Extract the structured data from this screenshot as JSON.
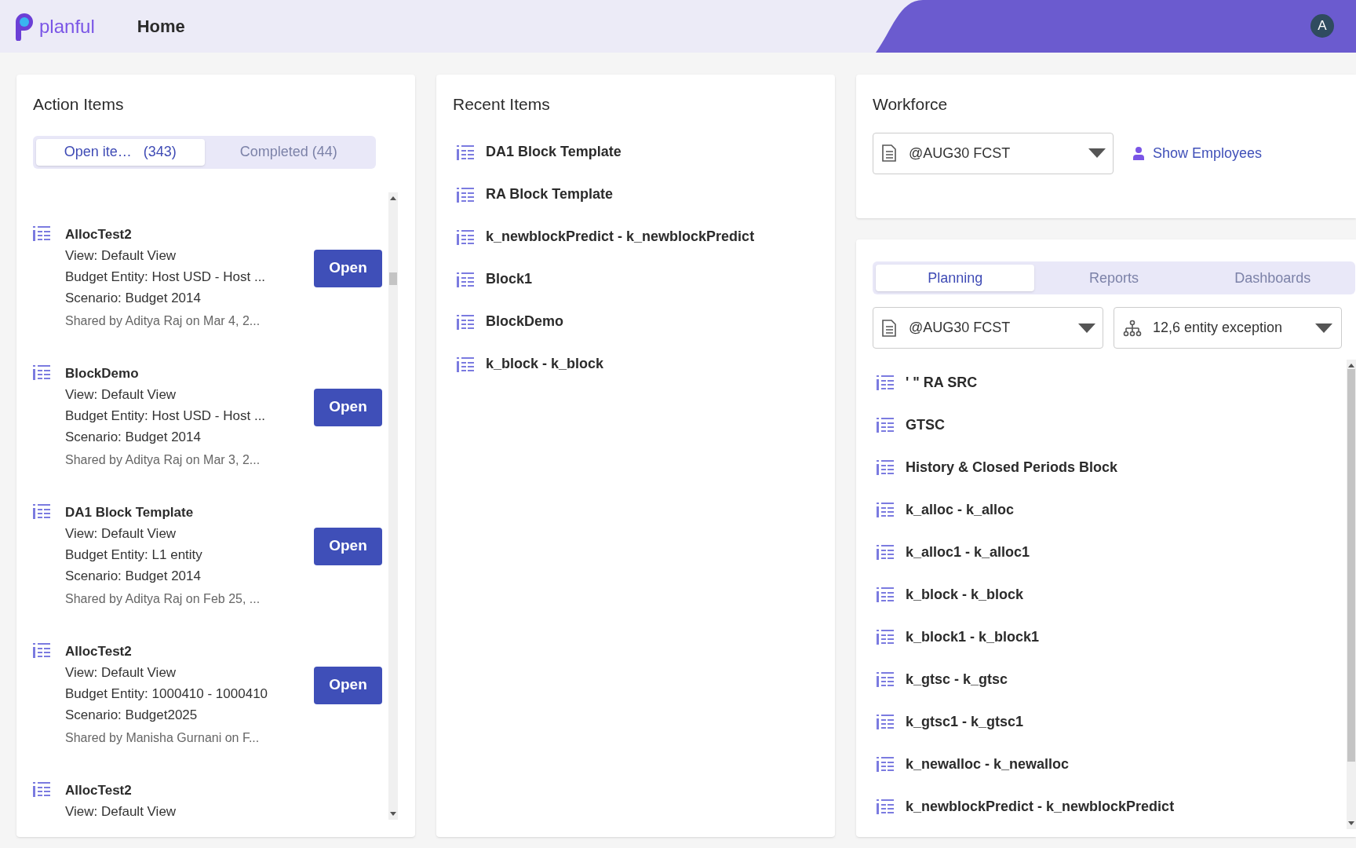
{
  "header": {
    "brand": "planful",
    "title": "Home",
    "avatar": "A"
  },
  "action_items": {
    "title": "Action Items",
    "tabs": [
      {
        "label": "Open ite…   (343)",
        "selected": true
      },
      {
        "label": "Completed (44)",
        "selected": false
      }
    ],
    "items": [
      {
        "name": "AllocTest2",
        "lines": [
          "View: Default View",
          "Budget Entity: Host USD - Host ...",
          "Scenario: Budget 2014"
        ],
        "shared": "Shared by Aditya Raj on Mar 4, 2...",
        "button": "Open"
      },
      {
        "name": "BlockDemo",
        "lines": [
          "View: Default View",
          "Budget Entity: Host USD - Host ...",
          "Scenario: Budget 2014"
        ],
        "shared": "Shared by Aditya Raj on Mar 3, 2...",
        "button": "Open"
      },
      {
        "name": "DA1 Block Template",
        "lines": [
          "View: Default View",
          "Budget Entity: L1 entity",
          "Scenario: Budget 2014"
        ],
        "shared": "Shared by Aditya Raj on Feb 25, ...",
        "button": "Open"
      },
      {
        "name": "AllocTest2",
        "lines": [
          "View: Default View",
          "Budget Entity: 1000410 - 1000410",
          "Scenario: Budget2025"
        ],
        "shared": "Shared by Manisha Gurnani on F...",
        "button": "Open"
      },
      {
        "name": "AllocTest2",
        "lines": [
          "View: Default View"
        ]
      }
    ]
  },
  "recent_items": {
    "title": "Recent Items",
    "items": [
      "DA1 Block Template",
      "RA Block Template",
      "k_newblockPredict - k_newblockPredict",
      "Block1",
      "BlockDemo",
      "k_block - k_block"
    ]
  },
  "workforce": {
    "title": "Workforce",
    "scenario": "@AUG30 FCST",
    "link": "Show Employees"
  },
  "planning": {
    "tabs": [
      {
        "label": "Planning",
        "selected": true
      },
      {
        "label": "Reports",
        "selected": false
      },
      {
        "label": "Dashboards",
        "selected": false
      }
    ],
    "scenario": "@AUG30 FCST",
    "entity": "12,6 entity exception",
    "items": [
      "' \" RA SRC",
      "GTSC",
      "History & Closed Periods Block",
      "k_alloc - k_alloc",
      "k_alloc1 - k_alloc1",
      "k_block - k_block",
      "k_block1 - k_block1",
      "k_gtsc - k_gtsc",
      "k_gtsc1 - k_gtsc1",
      "k_newalloc - k_newalloc",
      "k_newblockPredict - k_newblockPredict"
    ]
  }
}
